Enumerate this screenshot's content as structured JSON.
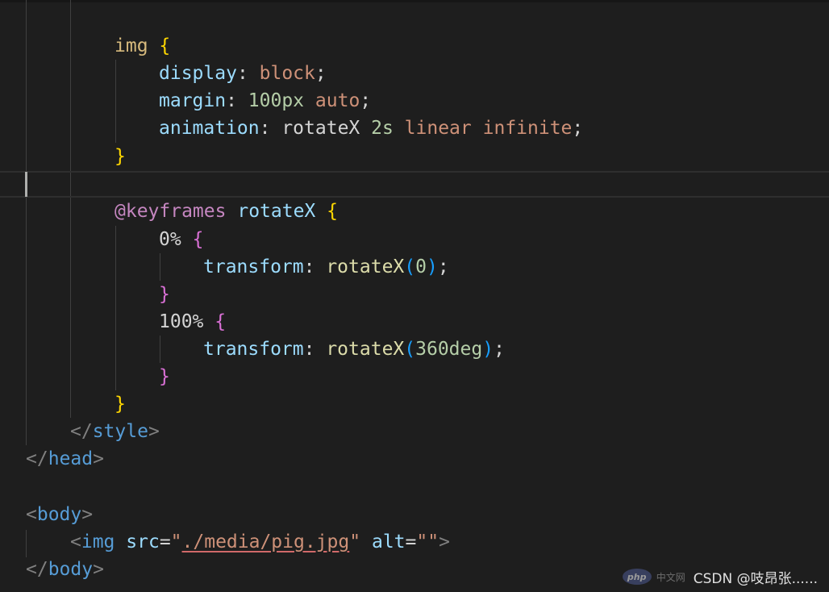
{
  "editor": {
    "lines": [
      [
        {
          "t": "img ",
          "c": "c-sel"
        },
        {
          "t": "{",
          "c": "c-b1"
        }
      ],
      [
        {
          "t": "display",
          "c": "c-prop"
        },
        {
          "t": ": ",
          "c": "c-txt"
        },
        {
          "t": "block",
          "c": "c-val"
        },
        {
          "t": ";",
          "c": "c-txt"
        }
      ],
      [
        {
          "t": "margin",
          "c": "c-prop"
        },
        {
          "t": ": ",
          "c": "c-txt"
        },
        {
          "t": "100px",
          "c": "c-num"
        },
        {
          "t": " ",
          "c": "c-txt"
        },
        {
          "t": "auto",
          "c": "c-val"
        },
        {
          "t": ";",
          "c": "c-txt"
        }
      ],
      [
        {
          "t": "animation",
          "c": "c-prop"
        },
        {
          "t": ": ",
          "c": "c-txt"
        },
        {
          "t": "rotateX ",
          "c": "c-txt"
        },
        {
          "t": "2s",
          "c": "c-num"
        },
        {
          "t": " ",
          "c": "c-txt"
        },
        {
          "t": "linear",
          "c": "c-val"
        },
        {
          "t": " ",
          "c": "c-txt"
        },
        {
          "t": "infinite",
          "c": "c-val"
        },
        {
          "t": ";",
          "c": "c-txt"
        }
      ],
      [
        {
          "t": "}",
          "c": "c-b1"
        }
      ],
      [
        {
          "t": "",
          "c": "c-txt"
        }
      ],
      [
        {
          "t": "@keyframes",
          "c": "c-at"
        },
        {
          "t": " ",
          "c": "c-txt"
        },
        {
          "t": "rotateX",
          "c": "c-prop"
        },
        {
          "t": " ",
          "c": "c-txt"
        },
        {
          "t": "{",
          "c": "c-b1"
        }
      ],
      [
        {
          "t": "0%",
          "c": "c-txt"
        },
        {
          "t": " ",
          "c": "c-txt"
        },
        {
          "t": "{",
          "c": "c-b2"
        }
      ],
      [
        {
          "t": "transform",
          "c": "c-prop"
        },
        {
          "t": ": ",
          "c": "c-txt"
        },
        {
          "t": "rotateX",
          "c": "c-fn"
        },
        {
          "t": "(",
          "c": "c-b3"
        },
        {
          "t": "0",
          "c": "c-num"
        },
        {
          "t": ")",
          "c": "c-b3"
        },
        {
          "t": ";",
          "c": "c-txt"
        }
      ],
      [
        {
          "t": "}",
          "c": "c-b2"
        }
      ],
      [
        {
          "t": "100%",
          "c": "c-txt"
        },
        {
          "t": " ",
          "c": "c-txt"
        },
        {
          "t": "{",
          "c": "c-b2"
        }
      ],
      [
        {
          "t": "transform",
          "c": "c-prop"
        },
        {
          "t": ": ",
          "c": "c-txt"
        },
        {
          "t": "rotateX",
          "c": "c-fn"
        },
        {
          "t": "(",
          "c": "c-b3"
        },
        {
          "t": "360deg",
          "c": "c-num"
        },
        {
          "t": ")",
          "c": "c-b3"
        },
        {
          "t": ";",
          "c": "c-txt"
        }
      ],
      [
        {
          "t": "}",
          "c": "c-b2"
        }
      ],
      [
        {
          "t": "}",
          "c": "c-b1"
        }
      ],
      [
        {
          "t": "</",
          "c": "c-ang"
        },
        {
          "t": "style",
          "c": "c-tag"
        },
        {
          "t": ">",
          "c": "c-ang"
        }
      ],
      [
        {
          "t": "</",
          "c": "c-ang"
        },
        {
          "t": "head",
          "c": "c-tag"
        },
        {
          "t": ">",
          "c": "c-ang"
        }
      ],
      [
        {
          "t": "",
          "c": "c-txt"
        }
      ],
      [
        {
          "t": "<",
          "c": "c-ang"
        },
        {
          "t": "body",
          "c": "c-tag"
        },
        {
          "t": ">",
          "c": "c-ang"
        }
      ],
      [
        {
          "t": "<",
          "c": "c-ang"
        },
        {
          "t": "img",
          "c": "c-tag"
        },
        {
          "t": " ",
          "c": "c-txt"
        },
        {
          "t": "src",
          "c": "c-prop"
        },
        {
          "t": "=",
          "c": "c-txt"
        },
        {
          "t": "\"",
          "c": "c-str"
        },
        {
          "t": "./media/pig.jpg",
          "c": "c-str underline"
        },
        {
          "t": "\"",
          "c": "c-str"
        },
        {
          "t": " ",
          "c": "c-txt"
        },
        {
          "t": "alt",
          "c": "c-prop"
        },
        {
          "t": "=",
          "c": "c-txt"
        },
        {
          "t": "\"\"",
          "c": "c-str"
        },
        {
          "t": ">",
          "c": "c-ang"
        }
      ],
      [
        {
          "t": "</",
          "c": "c-ang"
        },
        {
          "t": "body",
          "c": "c-tag"
        },
        {
          "t": ">",
          "c": "c-ang"
        }
      ]
    ]
  },
  "watermark": {
    "php_logo": "php",
    "php_cn": "中文网",
    "csdn": "CSDN @吱昂张......"
  }
}
